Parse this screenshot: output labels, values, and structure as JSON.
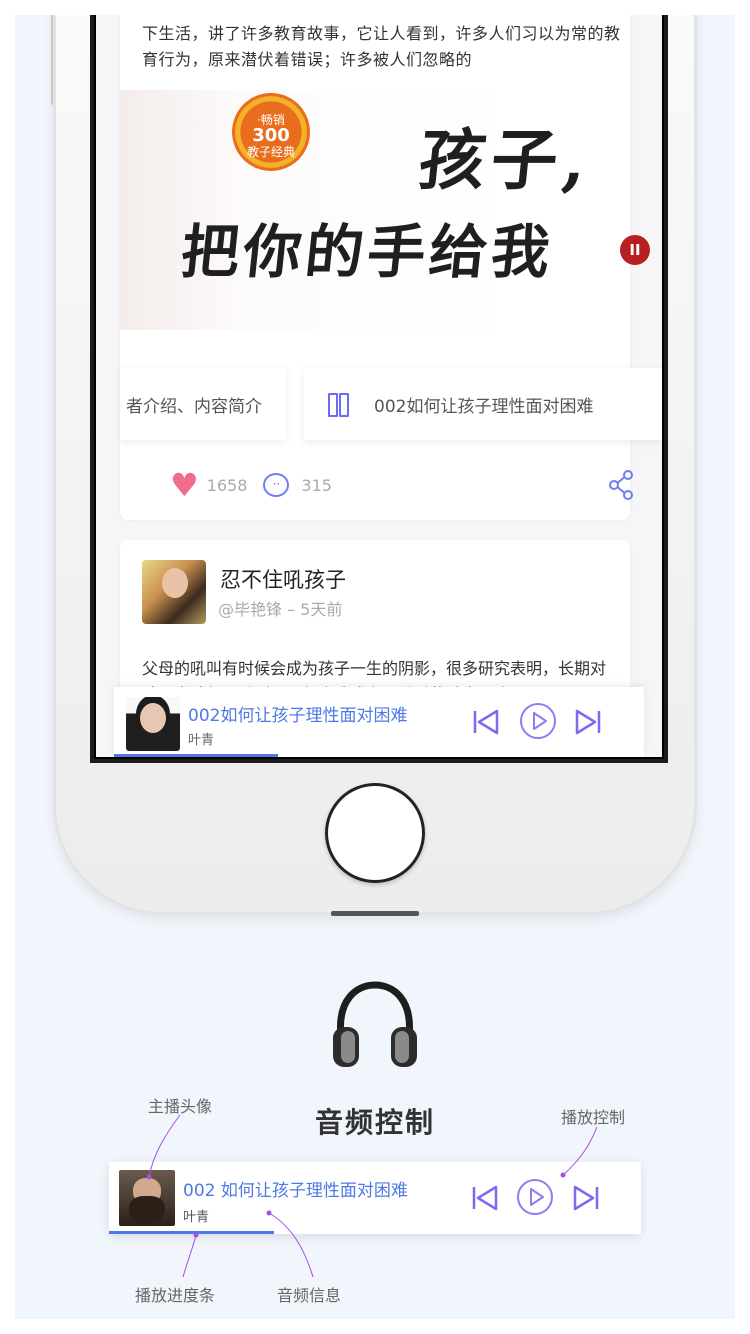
{
  "feed": {
    "excerpt": "尹建莉，教育专家，从教多年，她的《好妈妈胜过好老师》紧贴当下生活，讲了许多教育故事，它让人看到，许多人们习以为常的教育行为，原来潜伏着错误；许多被人们忽略的",
    "book": {
      "badge_line1": "·畅销",
      "badge_line2": "300",
      "badge_line3": "教子经典",
      "title_line1": "孩子,",
      "title_line2": "把你的手给我",
      "volume": "II"
    },
    "tab_left": "者介绍、内容简介",
    "tab_right": "002如何让孩子理性面对困难",
    "likes": "1658",
    "comments": "315"
  },
  "post": {
    "title": "忍不住吼孩子",
    "meta": "@毕艳锋 – 5天前",
    "body": "父母的吼叫有时候会成为孩子一生的阴影，很多研究表明，长期对孩子发脾气、吼叫，不但会造成亲子关系的疏离，也"
  },
  "mini_player": {
    "title": "002如何让孩子理性面对困难",
    "host": "叶青",
    "progress": 0.31
  },
  "section": {
    "title": "音频控制"
  },
  "big_player": {
    "title": "002 如何让孩子理性面对困难",
    "host": "叶青",
    "progress": 0.31
  },
  "callouts": {
    "avatar": "主播头像",
    "controls": "播放控制",
    "progress": "播放进度条",
    "info": "音频信息"
  },
  "colors": {
    "accent": "#4e78e6",
    "control": "#7a6cf0",
    "like": "#f06c8c",
    "callout_line": "#a64ee8"
  }
}
